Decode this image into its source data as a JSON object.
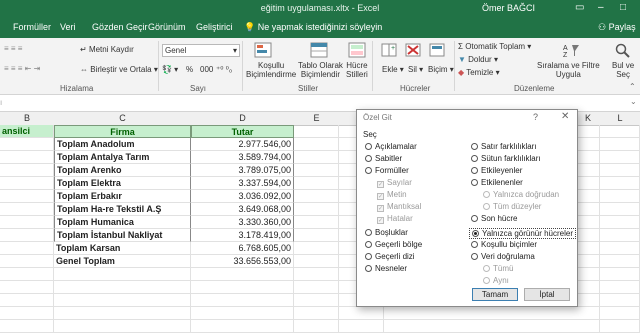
{
  "window": {
    "title": "eğitim uygulaması.xltx - Excel",
    "user": "Ömer BAĞCI",
    "share": "Paylaş"
  },
  "tabs": [
    "Formüller",
    "Veri",
    "Gözden Geçir",
    "Görünüm",
    "Geliştirici"
  ],
  "tell_me": "Ne yapmak istediğinizi söyleyin",
  "ribbon": {
    "cut": "Metni Kaydır",
    "merge": "Birleştir ve Ortala",
    "number_format": "Genel",
    "percent": "%",
    "thousands": "000",
    "cond_format": "Koşullu\nBiçimlendirme",
    "format_table": "Tablo Olarak\nBiçimlendir",
    "cell_styles": "Hücre\nStilleri",
    "insert": "Ekle",
    "delete": "Sil",
    "format": "Biçim",
    "autosum": "Otomatik Toplam",
    "fill": "Doldur",
    "clear": "Temizle",
    "sort_filter": "Sıralama ve Filtre\nUygula",
    "find_select": "Bul ve\nSeç",
    "groups": {
      "alignment": "Hizalama",
      "number": "Sayı",
      "styles": "Stiller",
      "cells": "Hücreler",
      "editing": "Düzenleme"
    }
  },
  "columns": [
    "B",
    "C",
    "D",
    "E",
    "F",
    "K",
    "L"
  ],
  "header_row": {
    "b": "ansilci",
    "c": "Firma",
    "d": "Tutar"
  },
  "rows": [
    {
      "firma": "Toplam Anadolum",
      "tutar": "2.977.546,00"
    },
    {
      "firma": "Toplam Antalya Tarım",
      "tutar": "3.589.794,00"
    },
    {
      "firma": "Toplam Arenko",
      "tutar": "3.789.075,00"
    },
    {
      "firma": "Toplam Elektra",
      "tutar": "3.337.594,00"
    },
    {
      "firma": "Toplam Erbakır",
      "tutar": "3.036.092,00"
    },
    {
      "firma": "Toplam Ha-re Tekstil A.Ş",
      "tutar": "3.649.068,00"
    },
    {
      "firma": "Toplam Humanica",
      "tutar": "3.330.360,00"
    },
    {
      "firma": "Toplam İstanbul Nakliyat",
      "tutar": "3.178.419,00"
    },
    {
      "firma": "Toplam Karsan",
      "tutar": "6.768.605,00"
    },
    {
      "firma": "Genel Toplam",
      "tutar": "33.656.553,00"
    }
  ],
  "dialog": {
    "title": "Özel Git",
    "help": "?",
    "close": "✕",
    "section": "Seç",
    "left": [
      "Açıklamalar",
      "Sabitler",
      "Formüller",
      "Sayılar",
      "Metin",
      "Mantıksal",
      "Hatalar",
      "Boşluklar",
      "Geçerli bölge",
      "Geçerli dizi",
      "Nesneler"
    ],
    "right": [
      "Satır farklılıkları",
      "Sütun farklılıkları",
      "Etkileyenler",
      "Etkilenenler",
      "Yalnızca doğrudan",
      "Tüm düzeyler",
      "Son hücre",
      "Yalnızca görünür hücreler",
      "Koşullu biçimler",
      "Veri doğrulama",
      "Tümü",
      "Aynı"
    ],
    "ok": "Tamam",
    "cancel": "İptal"
  },
  "colors": {
    "accent": "#217346",
    "header_fill": "#c6efce",
    "header_text": "#006100"
  }
}
